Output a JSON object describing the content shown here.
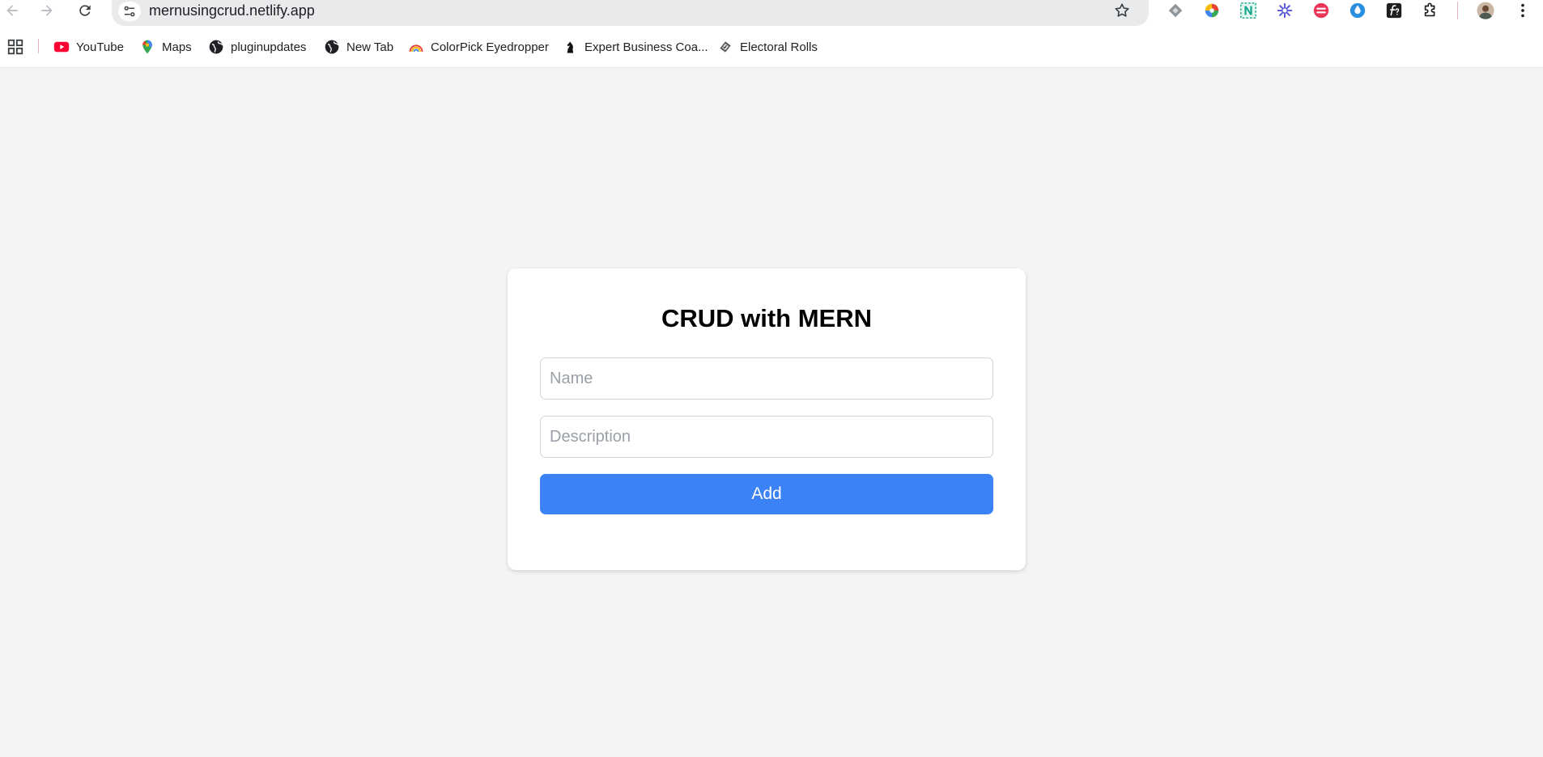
{
  "browser": {
    "url": "mernusingcrud.netlify.app",
    "bookmarks": [
      {
        "label": "YouTube",
        "icon": "youtube-icon"
      },
      {
        "label": "Maps",
        "icon": "maps-pin-icon"
      },
      {
        "label": "pluginupdates",
        "icon": "globe-icon"
      },
      {
        "label": "New Tab",
        "icon": "globe-icon"
      },
      {
        "label": "ColorPick Eyedropper",
        "icon": "rainbow-icon"
      },
      {
        "label": "Expert Business Coa...",
        "icon": "chess-knight-icon"
      },
      {
        "label": "Electoral Rolls",
        "icon": "ballot-icon"
      }
    ],
    "extensions": [
      "diamond-extension-icon",
      "color-wheel-extension-icon",
      "n-extension-icon",
      "spark-extension-icon",
      "red-circle-extension-icon",
      "droplet-extension-icon",
      "fx-extension-icon",
      "puzzle-icon"
    ]
  },
  "page": {
    "title": "CRUD with MERN",
    "name_placeholder": "Name",
    "name_value": "",
    "description_placeholder": "Description",
    "description_value": "",
    "add_label": "Add"
  },
  "colors": {
    "page_background": "#f3f4f6",
    "button": "#3b82f6",
    "button_text": "#ffffff"
  }
}
